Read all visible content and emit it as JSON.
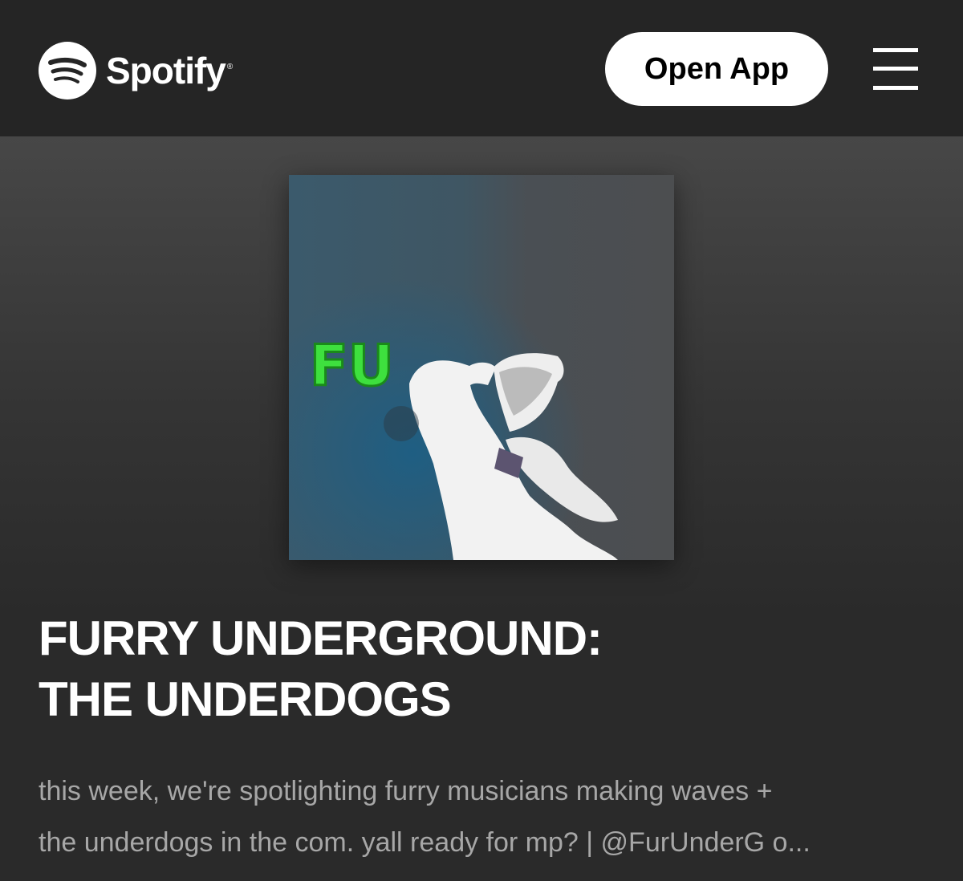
{
  "header": {
    "brand_name": "Spotify",
    "brand_reg_mark": "®",
    "open_app_label": "Open App",
    "menu_icon": "hamburger-menu-icon",
    "logo_icon": "spotify-logo-icon"
  },
  "playlist": {
    "cover_text": "FU",
    "title_line1": "FURRY UNDERGROUND:",
    "title_line2": "THE UNDERDOGS",
    "description_line1": "this week, we're spotlighting furry musicians making waves +",
    "description_line2": "the underdogs in the com. yall ready for mp? | @FurUnderG o..."
  },
  "colors": {
    "header_bg": "#252525",
    "page_bg": "#2a2a2a",
    "button_bg": "#ffffff",
    "description_text": "#a7a7a7",
    "cover_accent_green": "#3ee03e",
    "cover_bg_blue": "#3a5566"
  }
}
